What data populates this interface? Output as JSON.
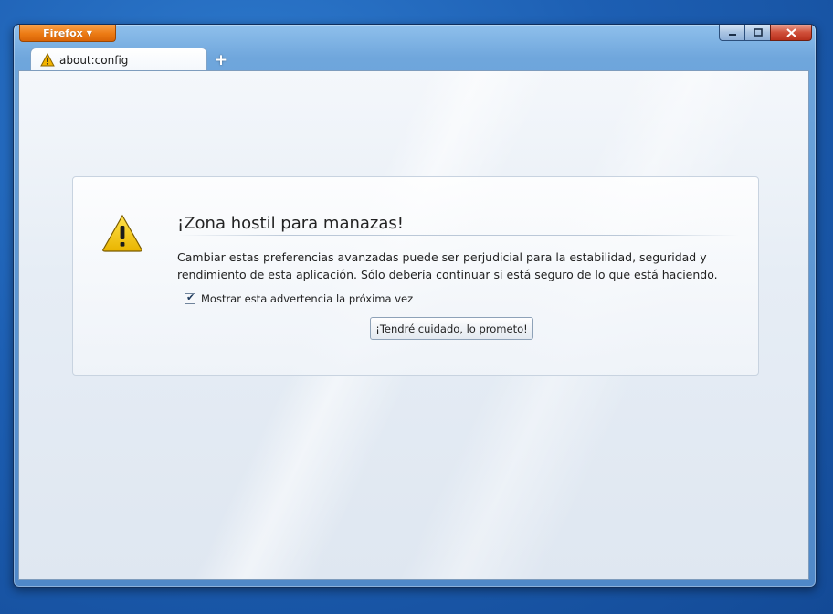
{
  "window": {
    "app_button_label": "Firefox",
    "caption_buttons": [
      "minimize",
      "maximize",
      "close"
    ]
  },
  "tabs": [
    {
      "label": "about:config",
      "icon": "warning-icon"
    }
  ],
  "new_tab_label": "+",
  "warning": {
    "title": "¡Zona hostil para manazas!",
    "message": "Cambiar estas preferencias avanzadas puede ser perjudicial para la estabilidad, seguridad y rendimiento de esta aplicación. Sólo debería continuar si está seguro de lo que está haciendo.",
    "checkbox_label": "Mostrar esta advertencia la próxima vez",
    "checkbox_checked": true,
    "button_label": "¡Tendré cuidado, lo prometo!"
  },
  "colors": {
    "firefox_button": "#ec7b14",
    "close_button": "#c8402a",
    "warning_yellow": "#f2c200"
  }
}
